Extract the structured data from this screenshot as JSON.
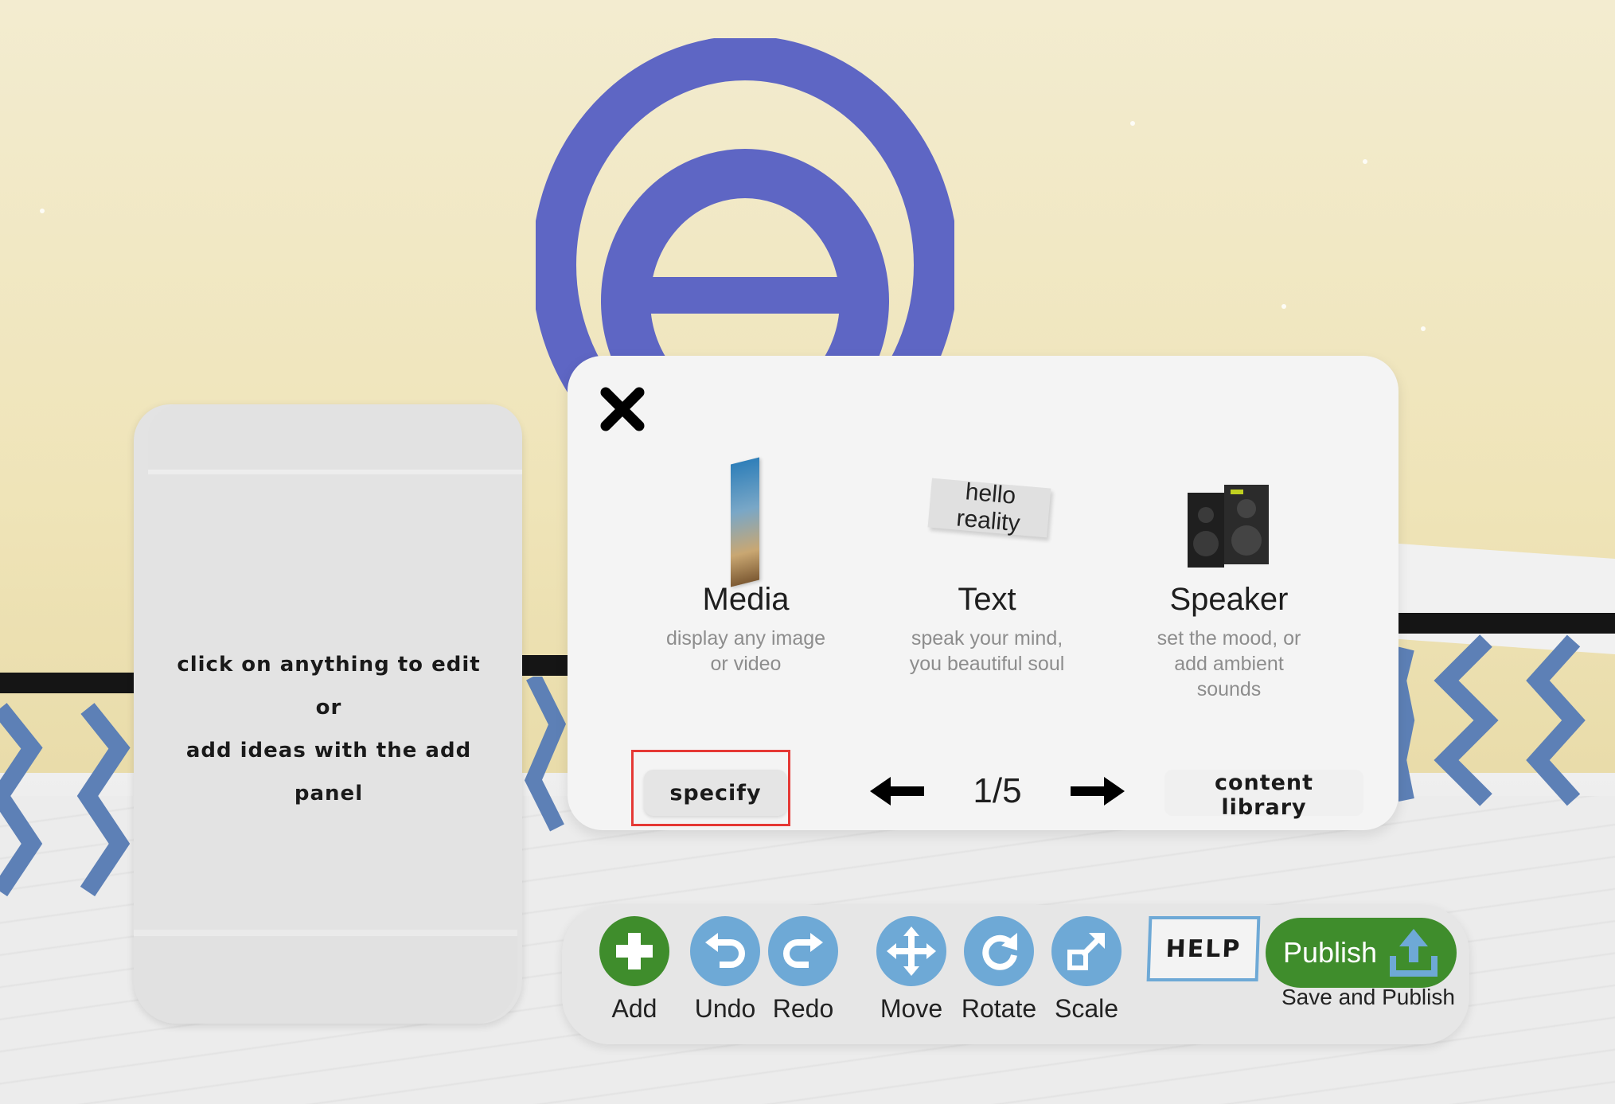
{
  "side_panel": {
    "line1": "click on anything to edit",
    "line2": "or",
    "line3": "add ideas with the add panel"
  },
  "add_panel": {
    "close_icon": "close-icon",
    "items": [
      {
        "title": "Media",
        "desc_lines": [
          "display any image",
          "or video"
        ],
        "icon": "media-icon"
      },
      {
        "title": "Text",
        "thumb_text": "hello reality",
        "desc_lines": [
          "speak your mind,",
          "you beautiful soul"
        ],
        "icon": "text-icon"
      },
      {
        "title": "Speaker",
        "desc_lines": [
          "set the mood, or",
          "add ambient",
          "sounds"
        ],
        "icon": "speaker-icon"
      }
    ],
    "specify_label": "specify",
    "page": "1/5",
    "content_library_label": "content library"
  },
  "toolbar": {
    "add": "Add",
    "undo": "Undo",
    "redo": "Redo",
    "move": "Move",
    "rotate": "Rotate",
    "scale": "Scale",
    "help": "HELP",
    "publish": "Publish",
    "publish_sub": "Save and Publish"
  },
  "colors": {
    "logo": "#5e66c4",
    "green": "#3f8d2c",
    "tool_blue": "#6ea9d6",
    "highlight": "#e53935"
  }
}
